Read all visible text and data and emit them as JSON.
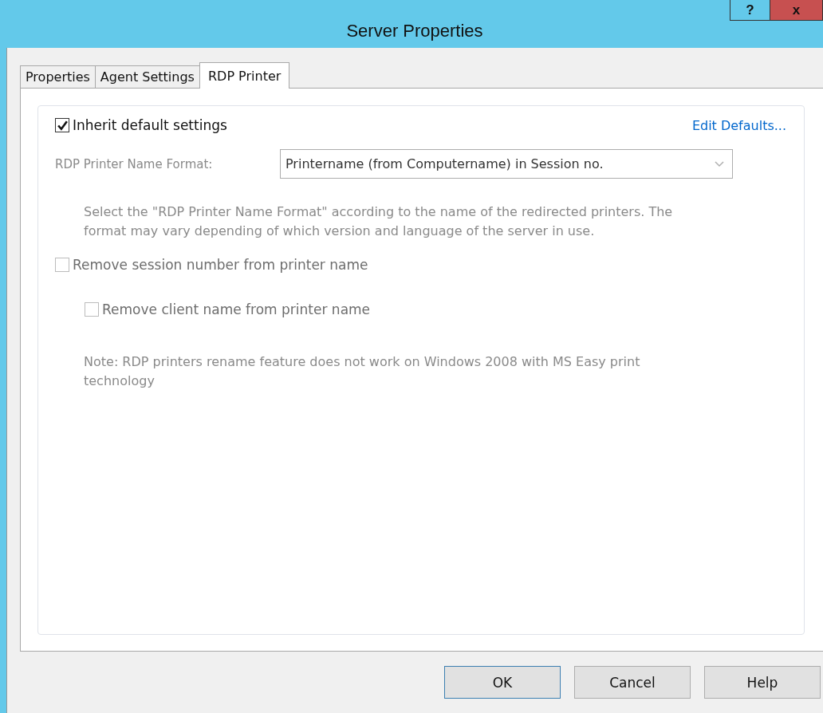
{
  "window": {
    "title": "Server Properties",
    "help_button": "?",
    "close_button": "x"
  },
  "tabs": [
    {
      "label": "Properties",
      "selected": false
    },
    {
      "label": "Agent Settings",
      "selected": false
    },
    {
      "label": "RDP Printer",
      "selected": true
    }
  ],
  "inherit": {
    "label": "Inherit default settings",
    "checked": true,
    "disabled": false
  },
  "edit_defaults_link": "Edit Defaults...",
  "name_format": {
    "label": "RDP Printer Name Format:",
    "value": "Printername (from Computername) in Session no.",
    "disabled": true
  },
  "description": "Select the \"RDP Printer Name Format\" according to the name of the redirected printers. The format may vary depending of which version and language of the server in use.",
  "options": [
    {
      "label": "Remove session number from printer name",
      "checked": false,
      "disabled": true,
      "children": [
        {
          "label": "Remove client name from printer name",
          "checked": false,
          "disabled": true
        }
      ]
    }
  ],
  "note": "Note: RDP printers rename feature does not work on Windows 2008 with MS Easy print technology",
  "buttons": [
    {
      "label": "OK",
      "default": true
    },
    {
      "label": "Cancel",
      "default": false
    },
    {
      "label": "Help",
      "default": false
    }
  ]
}
